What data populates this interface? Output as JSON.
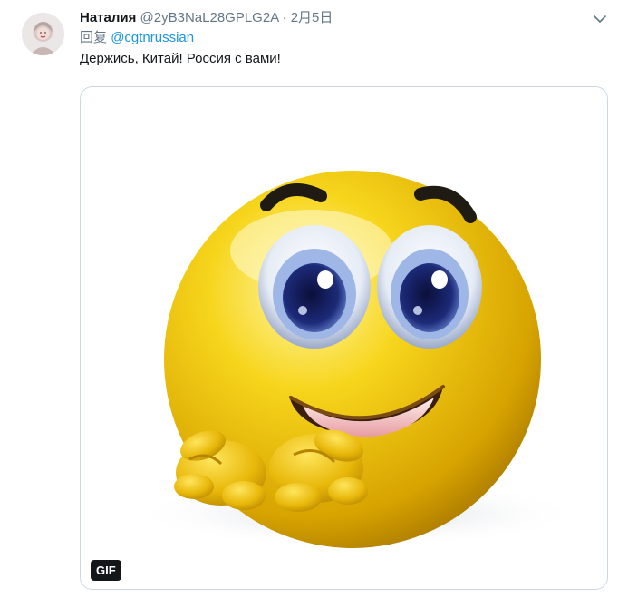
{
  "tweet": {
    "display_name": "Наталия",
    "handle": "@2yB3NaL28GPLG2A",
    "separator": "·",
    "date": "2月5日",
    "reply_prefix": "回复",
    "reply_to": "@cgtnrussian",
    "text": "Держись, Китай! Россия с вами!"
  },
  "media": {
    "badge": "GIF",
    "subject": "smiley-emoji-gif"
  },
  "icons": {
    "menu": "chevron-down-icon",
    "avatar": "user-avatar"
  },
  "colors": {
    "text_primary": "#14171a",
    "text_secondary": "#657786",
    "link": "#1b95e0",
    "border": "#ccd6dd",
    "badge_bg": "#14171a"
  }
}
